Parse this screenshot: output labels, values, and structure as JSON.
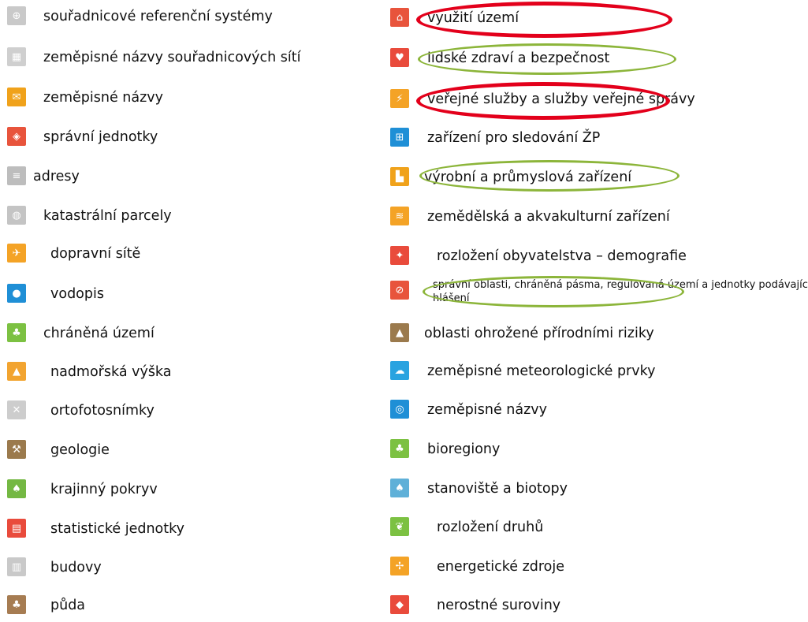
{
  "left_items": [
    {
      "label": "souřadnicové referenční systémy",
      "icon": "globe-grid-icon",
      "color": "#c9c9c9",
      "glyph": "⊕"
    },
    {
      "label": "zeměpisné názvy souřadnicových sítí",
      "icon": "grid-icon",
      "color": "#cfcfcf",
      "glyph": "▦"
    },
    {
      "label": "zeměpisné názvy",
      "icon": "mailbox-icon",
      "color": "#f0a21b",
      "glyph": "✉"
    },
    {
      "label": "správní jednotky",
      "icon": "map-regions-icon",
      "color": "#e8543c",
      "glyph": "◈"
    },
    {
      "label": "adresy",
      "icon": "address-text-icon",
      "color": "#bdbdbd",
      "glyph": "≡"
    },
    {
      "label": "katastrální parcely",
      "icon": "parcel-globe-icon",
      "color": "#c4c4c4",
      "glyph": "◍"
    },
    {
      "label": "dopravní sítě",
      "icon": "transport-icon",
      "color": "#f4a326",
      "glyph": "✈"
    },
    {
      "label": "vodopis",
      "icon": "water-drop-icon",
      "color": "#1f8fd6",
      "glyph": "●"
    },
    {
      "label": "chráněná území",
      "icon": "protected-sprout-icon",
      "color": "#7cc142",
      "glyph": "♣"
    },
    {
      "label": "nadmořská výška",
      "icon": "elevation-icon",
      "color": "#f2a430",
      "glyph": "▲"
    },
    {
      "label": "ortofotosnímky",
      "icon": "orthophoto-icon",
      "color": "#cdcdcd",
      "glyph": "✕"
    },
    {
      "label": "geologie",
      "icon": "pickaxe-icon",
      "color": "#9b7a4d",
      "glyph": "⚒"
    },
    {
      "label": "krajinný pokryv",
      "icon": "landcover-tree-icon",
      "color": "#74b843",
      "glyph": "♠"
    },
    {
      "label": "statistické jednotky",
      "icon": "statistics-grid-icon",
      "color": "#e94b3c",
      "glyph": "▤"
    },
    {
      "label": "budovy",
      "icon": "buildings-icon",
      "color": "#c9c9c9",
      "glyph": "▥"
    },
    {
      "label": "půda",
      "icon": "soil-sprout-icon",
      "color": "#a67c52",
      "glyph": "♣"
    }
  ],
  "right_items": [
    {
      "label": "využití území",
      "icon": "land-use-icon",
      "color": "#e8543c",
      "glyph": "⌂"
    },
    {
      "label": "lidské zdraví a bezpečnost",
      "icon": "heart-health-icon",
      "color": "#e94b3c",
      "glyph": "♥"
    },
    {
      "label": "veřejné služby a služby veřejné správy",
      "icon": "utility-tower-icon",
      "color": "#f4a326",
      "glyph": "⚡"
    },
    {
      "label": "zařízení pro sledování ŽP",
      "icon": "monitoring-station-icon",
      "color": "#1f8fd6",
      "glyph": "⊞"
    },
    {
      "label": "výrobní a průmyslová zařízení",
      "icon": "factory-icon",
      "color": "#f0a21b",
      "glyph": "▙"
    },
    {
      "label": "zemědělská a akvakulturní zařízení",
      "icon": "agriculture-fish-icon",
      "color": "#f4a326",
      "glyph": "≋"
    },
    {
      "label": "rozložení obyvatelstva – demografie",
      "icon": "population-icon",
      "color": "#e94b3c",
      "glyph": "✦"
    },
    {
      "label": "správní oblasti, chráněná pásma, regulovaná území a jednotky podávající hlášení",
      "icon": "restricted-zone-icon",
      "color": "#e8543c",
      "glyph": "⊘",
      "small": true
    },
    {
      "label": "oblasti ohrožené přírodními riziky",
      "icon": "natural-hazard-icon",
      "color": "#9b7a4d",
      "glyph": "▲"
    },
    {
      "label": "zeměpisné meteorologické prvky",
      "icon": "weather-icon",
      "color": "#29a3e0",
      "glyph": "☁"
    },
    {
      "label": "zeměpisné názvy",
      "icon": "ocean-globe-icon",
      "color": "#1f8fd6",
      "glyph": "◎"
    },
    {
      "label": "bioregiony",
      "icon": "bioregion-icon",
      "color": "#7cc142",
      "glyph": "♣"
    },
    {
      "label": "stanoviště a biotopy",
      "icon": "habitat-icon",
      "color": "#5fb0d8",
      "glyph": "♠"
    },
    {
      "label": "rozložení druhů",
      "icon": "species-butterfly-icon",
      "color": "#7cc142",
      "glyph": "❦"
    },
    {
      "label": "energetické zdroje",
      "icon": "energy-turbine-icon",
      "color": "#f4a326",
      "glyph": "✢"
    },
    {
      "label": "nerostné suroviny",
      "icon": "mineral-gem-icon",
      "color": "#e94b3c",
      "glyph": "◆"
    }
  ],
  "highlights": [
    {
      "target": "využití území",
      "color": "#e3001b"
    },
    {
      "target": "lidské zdraví a bezpečnost",
      "color": "#8cb53a"
    },
    {
      "target": "veřejné služby a služby veřejné správy",
      "color": "#e3001b"
    },
    {
      "target": "výrobní a průmyslová zařízení",
      "color": "#8cb53a"
    },
    {
      "target": "správní oblasti, chráněná pásma, regulovaná území a jednotky podávající hlášení",
      "color": "#8cb53a"
    }
  ]
}
